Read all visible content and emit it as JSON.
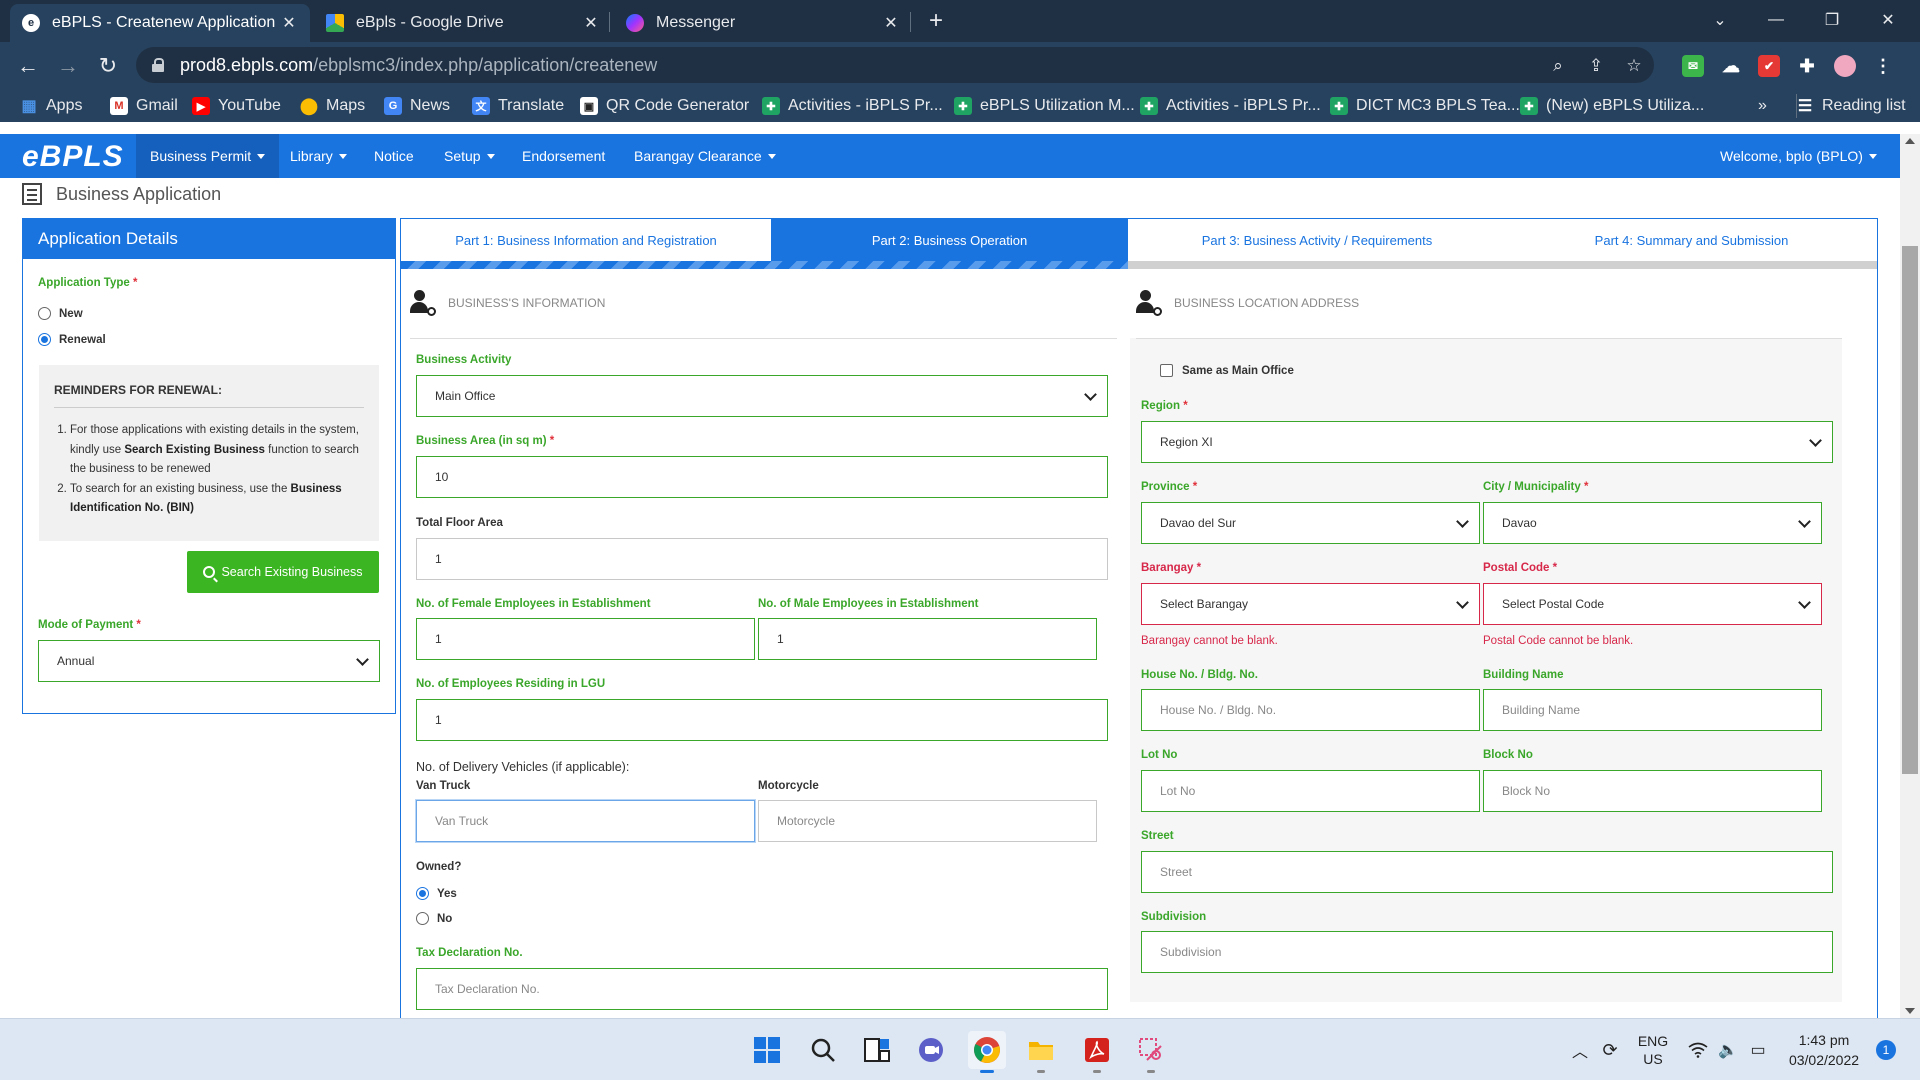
{
  "browser": {
    "tabs": [
      {
        "title": "eBPLS - Createnew Application",
        "icon": "ebpls-favicon",
        "active": true
      },
      {
        "title": "eBpls - Google Drive",
        "icon": "google-drive-icon",
        "active": false
      },
      {
        "title": "Messenger",
        "icon": "messenger-icon",
        "active": false
      }
    ],
    "url_host": "prod8.ebpls.com",
    "url_path": "/ebplsmc3/index.php/application/createnew",
    "bookmarks": [
      {
        "label": "Apps",
        "icon": "apps-grid-icon"
      },
      {
        "label": "Gmail",
        "icon": "gmail-icon"
      },
      {
        "label": "YouTube",
        "icon": "youtube-icon"
      },
      {
        "label": "Maps",
        "icon": "maps-icon"
      },
      {
        "label": "News",
        "icon": "news-icon"
      },
      {
        "label": "Translate",
        "icon": "translate-icon"
      },
      {
        "label": "QR Code Generator",
        "icon": "qr-code-icon"
      },
      {
        "label": "Activities - iBPLS Pr...",
        "icon": "green-cross-icon"
      },
      {
        "label": "eBPLS Utilization M...",
        "icon": "green-cross-icon"
      },
      {
        "label": "Activities - iBPLS Pr...",
        "icon": "green-cross-icon"
      },
      {
        "label": "DICT MC3 BPLS Tea...",
        "icon": "green-cross-icon"
      },
      {
        "label": "(New) eBPLS Utiliza...",
        "icon": "green-cross-icon"
      }
    ],
    "more_bookmarks": "»",
    "reading_list": "Reading list"
  },
  "app": {
    "brand": "eBPLS",
    "nav": [
      {
        "label": "Business Permit",
        "dropdown": true
      },
      {
        "label": "Library",
        "dropdown": true
      },
      {
        "label": "Notice",
        "dropdown": false
      },
      {
        "label": "Setup",
        "dropdown": true
      },
      {
        "label": "Endorsement",
        "dropdown": false
      },
      {
        "label": "Barangay Clearance",
        "dropdown": true
      }
    ],
    "welcome": "Welcome, bplo (BPLO)"
  },
  "page": {
    "title": "Business Application"
  },
  "details": {
    "header": "Application Details",
    "app_type_label": "Application Type",
    "types": [
      {
        "label": "New",
        "selected": false
      },
      {
        "label": "Renewal",
        "selected": true
      }
    ],
    "reminders_title": "REMINDERS FOR RENEWAL:",
    "reminder1": {
      "pre": "For those applications with existing details in the system, kindly use ",
      "bold": "Search Existing Business",
      "post": " function to search the business to be renewed"
    },
    "reminder2": {
      "pre": "To search for an existing business, use the ",
      "bold": "Business Identification No. (BIN)"
    },
    "search_button": "Search Existing Business",
    "payment_label": "Mode of Payment",
    "payment_value": "Annual"
  },
  "steps": [
    {
      "label": "Part 1: Business Information and Registration",
      "active": false
    },
    {
      "label": "Part 2: Business Operation",
      "active": true
    },
    {
      "label": "Part 3: Business Activity / Requirements",
      "active": false
    },
    {
      "label": "Part 4: Summary and Submission",
      "active": false
    }
  ],
  "business_info": {
    "section_title": "BUSINESS'S INFORMATION",
    "activity_label": "Business Activity",
    "activity_value": "Main Office",
    "area_label": "Business Area (in sq m)",
    "area_value": "10",
    "floor_label": "Total Floor Area",
    "floor_value": "1",
    "female_label": "No. of Female Employees in Establishment",
    "female_value": "1",
    "male_label": "No. of Male Employees in Establishment",
    "male_value": "1",
    "lgu_label": "No. of Employees Residing in LGU",
    "lgu_value": "1",
    "vehicles_label": "No. of Delivery Vehicles (if applicable):",
    "van_label": "Van Truck",
    "van_placeholder": "Van  Truck",
    "moto_label": "Motorcycle",
    "moto_placeholder": "Motorcycle",
    "owned_label": "Owned?",
    "owned_options": [
      {
        "label": "Yes",
        "selected": true
      },
      {
        "label": "No",
        "selected": false
      }
    ],
    "tax_label": "Tax Declaration No.",
    "tax_placeholder": "Tax Declaration No."
  },
  "location": {
    "section_title": "BUSINESS LOCATION ADDRESS",
    "same_label": "Same as Main Office",
    "same_checked": false,
    "region_label": "Region",
    "region_value": "Region XI",
    "province_label": "Province",
    "province_value": "Davao del Sur",
    "city_label": "City / Municipality",
    "city_value": "Davao",
    "barangay_label": "Barangay",
    "barangay_value": "Select Barangay",
    "barangay_error": "Barangay cannot be blank.",
    "postal_label": "Postal Code",
    "postal_value": "Select Postal Code",
    "postal_error": "Postal Code cannot be blank.",
    "house_label": "House No. / Bldg. No.",
    "house_placeholder": "House No. / Bldg. No.",
    "building_label": "Building Name",
    "building_placeholder": "Building Name",
    "lot_label": "Lot No",
    "lot_placeholder": "Lot  No",
    "block_label": "Block No",
    "block_placeholder": "Block  No",
    "street_label": "Street",
    "street_placeholder": "Street",
    "subdivision_label": "Subdivision",
    "subdivision_placeholder": "Subdivision"
  },
  "taskbar": {
    "apps": [
      {
        "name": "windows-start-icon"
      },
      {
        "name": "search-icon"
      },
      {
        "name": "task-view-icon"
      },
      {
        "name": "teams-chat-icon"
      },
      {
        "name": "chrome-icon"
      },
      {
        "name": "file-explorer-icon"
      },
      {
        "name": "acrobat-icon"
      },
      {
        "name": "snipping-tool-icon"
      }
    ],
    "lang_top": "ENG",
    "lang_bottom": "US",
    "time": "1:43 pm",
    "date": "03/02/2022",
    "notifications": "1"
  },
  "colors": {
    "brand_blue": "#1a74e0",
    "label_green": "#3aa62a",
    "error_red": "#d7284a",
    "button_green": "#3cb523"
  }
}
